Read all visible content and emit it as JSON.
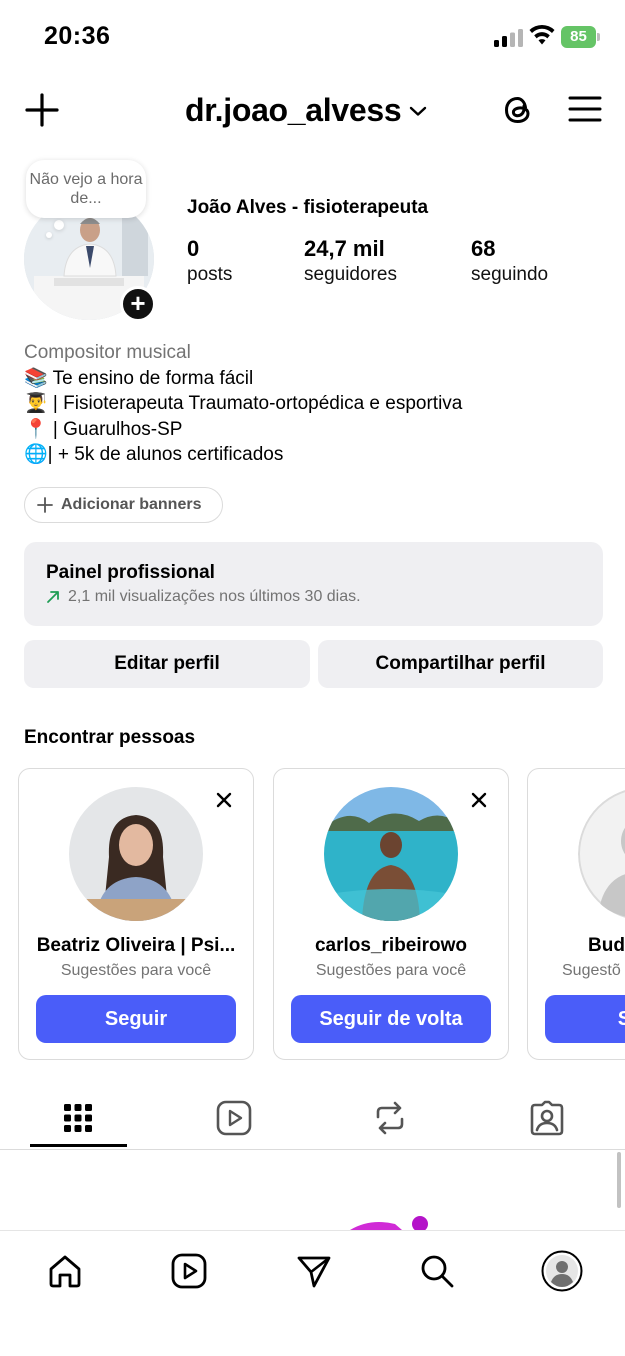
{
  "status_bar": {
    "time": "20:36",
    "battery": "85",
    "battery_color": "#65c466"
  },
  "header": {
    "username": "dr.joao_alvess",
    "plus_icon": "plus-icon",
    "threads_icon": "threads-icon",
    "menu_icon": "hamburger-menu-icon"
  },
  "profile": {
    "note": "Não vejo a hora de...",
    "display_name": "João Alves - fisioterapeuta",
    "stats": [
      {
        "value": "0",
        "label": "posts"
      },
      {
        "value": "24,7 mil",
        "label": "seguidores"
      },
      {
        "value": "68",
        "label": "seguindo"
      }
    ],
    "category": "Compositor musical",
    "bio_lines": [
      "📚 Te ensino de forma fácil",
      "👨‍🎓 | Fisioterapeuta Traumato-ortopédica e esportiva",
      "📍 | Guarulhos-SP",
      "🌐| + 5k de alunos certificados"
    ],
    "add_banners": "Adicionar banners"
  },
  "pro_panel": {
    "title": "Painel profissional",
    "subtitle": "2,1 mil visualizações nos últimos 30 dias."
  },
  "actions": {
    "edit": "Editar perfil",
    "share": "Compartilhar perfil"
  },
  "suggestions": {
    "title": "Encontrar pessoas",
    "cards": [
      {
        "name": "Beatriz Oliveira | Psi...",
        "sub": "Sugestões para você",
        "button": "Seguir"
      },
      {
        "name": "carlos_ribeirowo",
        "sub": "Sugestões para você",
        "button": "Seguir de volta"
      },
      {
        "name": "Bud",
        "sub": "Sugestõ",
        "button": "Segui"
      }
    ]
  },
  "tabs": [
    "grid-icon",
    "reels-icon",
    "reposts-icon",
    "tagged-icon"
  ],
  "bottom_nav": [
    "home-icon",
    "reels-icon",
    "direct-message-icon",
    "search-icon",
    "profile-avatar-icon"
  ],
  "accent_color": "#4a5df9"
}
